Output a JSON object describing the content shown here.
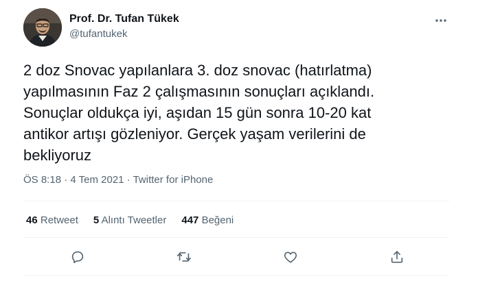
{
  "author": {
    "name": "Prof. Dr. Tufan Tükek",
    "handle": "@tufantukek"
  },
  "tweet": {
    "text": "2 doz Snovac yapılanlara 3. doz snovac (hatırlatma)\nyapılmasının Faz 2 çalışmasının sonuçları açıklandı.\nSonuçlar oldukça iyi, aşıdan 15 gün sonra 10-20 kat\nantikor artışı gözleniyor. Gerçek yaşam verilerini de\nbekliyoruz",
    "time": "ÖS 8:18",
    "date": "4 Tem 2021",
    "source": "Twitter for iPhone",
    "separator": "·"
  },
  "stats": {
    "retweets_count": "46",
    "retweets_label": "Retweet",
    "quotes_count": "5",
    "quotes_label": "Alıntı Tweetler",
    "likes_count": "447",
    "likes_label": "Beğeni"
  },
  "actions": {
    "reply_icon": "reply-icon",
    "retweet_icon": "retweet-icon",
    "like_icon": "heart-icon",
    "share_icon": "share-icon"
  },
  "colors": {
    "text": "#0f1419",
    "secondary": "#536471",
    "divider": "#eff3f4"
  }
}
